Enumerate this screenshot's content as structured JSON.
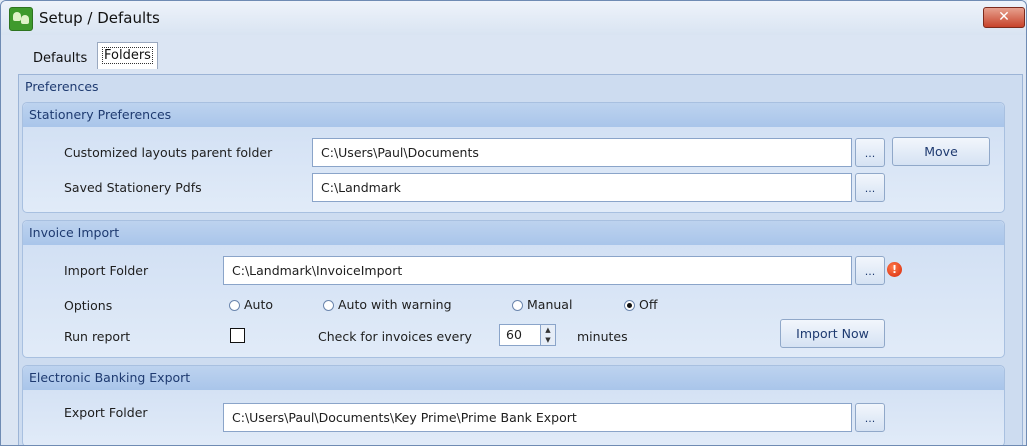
{
  "window": {
    "title": "Setup / Defaults",
    "close_label": "✕"
  },
  "tabs": [
    {
      "label": "Defaults",
      "active": false
    },
    {
      "label": "Folders",
      "active": true
    }
  ],
  "panel": {
    "title": "Preferences"
  },
  "stationery": {
    "header": "Stationery Preferences",
    "layouts_label": "Customized layouts parent folder",
    "layouts_value": "C:\\Users\\Paul\\Documents",
    "browse_label": "...",
    "move_label": "Move",
    "pdfs_label": "Saved Stationery Pdfs",
    "pdfs_value": "C:\\Landmark"
  },
  "invoice": {
    "header": "Invoice Import",
    "folder_label": "Import Folder",
    "folder_value": "C:\\Landmark\\InvoiceImport",
    "browse_label": "...",
    "warning_icon_text": "!",
    "options_label": "Options",
    "options": [
      {
        "label": "Auto",
        "checked": false
      },
      {
        "label": "Auto with warning",
        "checked": false
      },
      {
        "label": "Manual",
        "checked": false
      },
      {
        "label": "Off",
        "checked": true
      }
    ],
    "run_report_label": "Run report",
    "run_report_checked": false,
    "check_label": "Check for invoices every",
    "check_value": "60",
    "minutes_label": "minutes",
    "import_now_label": "Import Now"
  },
  "banking": {
    "header": "Electronic Banking Export",
    "folder_label": "Export Folder",
    "folder_value": "C:\\Users\\Paul\\Documents\\Key Prime\\Prime Bank Export",
    "browse_label": "..."
  },
  "colors": {
    "accent_text": "#1e3a70",
    "close_button": "#c7432b",
    "warning": "#d6280b"
  }
}
